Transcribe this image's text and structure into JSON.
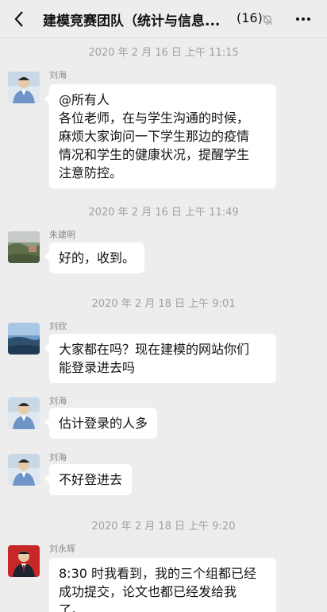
{
  "header": {
    "title": "建模竞赛团队（统计与信息...",
    "count": "(16)",
    "back_icon": "chevron-left-icon",
    "mute_icon": "bell-mute-icon",
    "more_icon": "more-dots-icon"
  },
  "messages": {
    "ts1": "2020 年 2 月 16 日 上午 11:15",
    "m1": {
      "sender": "刘海",
      "lines": [
        "@所有人",
        "各位老师，在与学生沟通的时候，",
        "麻烦大家询问一下学生那边的疫情",
        "情况和学生的健康状况，提醒学生",
        "注意防控。"
      ]
    },
    "ts2": "2020 年 2 月 16 日 上午 11:49",
    "m2": {
      "sender": "朱建明",
      "lines": [
        "好的，收到。"
      ]
    },
    "ts3": "2020 年 2 月 18 日 上午 9:01",
    "m3": {
      "sender": "刘欣",
      "lines": [
        "大家都在吗？现在建模的网站你们",
        "能登录进去吗"
      ]
    },
    "m4": {
      "sender": "刘海",
      "lines": [
        "估计登录的人多"
      ]
    },
    "m5": {
      "sender": "刘海",
      "lines": [
        "不好登进去"
      ]
    },
    "ts4": "2020 年 2 月 18 日 上午 9:20",
    "m6": {
      "sender": "刘永辉",
      "lines": [
        "8:30 时我看到，我的三个组都已经",
        "成功提交，论文也都已经发给我",
        "了。"
      ]
    }
  },
  "colors": {
    "background": "#ededed",
    "bubble": "#ffffff",
    "timestamp": "#a0a0a0",
    "sender": "#888888"
  }
}
